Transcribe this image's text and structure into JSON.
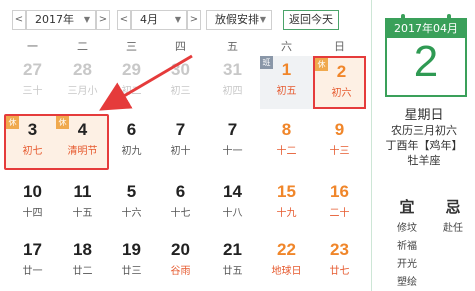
{
  "toolbar": {
    "prev": "<",
    "next": ">",
    "year": "2017年",
    "month": "4月",
    "holiday": "放假安排",
    "today": "返回今天"
  },
  "weekdays": [
    "一",
    "二",
    "三",
    "四",
    "五",
    "六",
    "日"
  ],
  "rows": [
    [
      {
        "d": "27",
        "l": "三十",
        "other": true
      },
      {
        "d": "28",
        "l": "三月小",
        "other": true
      },
      {
        "d": "29",
        "l": "初二",
        "other": true
      },
      {
        "d": "30",
        "l": "初三",
        "other": true
      },
      {
        "d": "31",
        "l": "初四",
        "other": true
      },
      {
        "d": "1",
        "l": "初五",
        "red": true,
        "badge": "班",
        "bg": "work"
      },
      {
        "d": "2",
        "l": "初六",
        "red": true,
        "badge": "休",
        "bg": "hol",
        "selected": true
      }
    ],
    [
      {
        "d": "3",
        "l": "初七",
        "badge": "休",
        "bg": "hol",
        "lred": true
      },
      {
        "d": "4",
        "l": "清明节",
        "badge": "休",
        "bg": "hol",
        "lred": true
      },
      {
        "d": "6",
        "l": "初九"
      },
      {
        "d": "7",
        "l": "初十"
      },
      {
        "d": "7",
        "l": "十一"
      },
      {
        "d": "8",
        "l": "十二",
        "red": true
      },
      {
        "d": "9",
        "l": "十三",
        "red": true
      }
    ],
    [
      {
        "d": "10",
        "l": "十四"
      },
      {
        "d": "11",
        "l": "十五"
      },
      {
        "d": "5",
        "l": "十六"
      },
      {
        "d": "6",
        "l": "十七"
      },
      {
        "d": "14",
        "l": "十八"
      },
      {
        "d": "15",
        "l": "十九",
        "red": true
      },
      {
        "d": "16",
        "l": "二十",
        "red": true
      }
    ],
    [
      {
        "d": "17",
        "l": "廿一"
      },
      {
        "d": "18",
        "l": "廿二"
      },
      {
        "d": "19",
        "l": "廿三"
      },
      {
        "d": "20",
        "l": "谷雨",
        "lred": true
      },
      {
        "d": "21",
        "l": "廿五"
      },
      {
        "d": "22",
        "l": "地球日",
        "red": true,
        "lred": true
      },
      {
        "d": "23",
        "l": "廿七",
        "red": true
      }
    ]
  ],
  "side": {
    "month_header": "2017年04月",
    "day": "2",
    "weekday": "星期日",
    "lunar": "农历三月初六",
    "ganzhi": "丁酉年【鸡年】",
    "zodiac": "牡羊座",
    "yi_label": "宜",
    "ji_label": "忌",
    "yi": [
      "修坟",
      "祈福",
      "开光",
      "塑绘"
    ],
    "ji": [
      "赴任"
    ]
  },
  "colors": {
    "accent_green": "#3aa05a",
    "weekend_orange": "#f0862a",
    "highlight_red": "#e53b3b",
    "holiday_bg": "#fdf0e4"
  }
}
